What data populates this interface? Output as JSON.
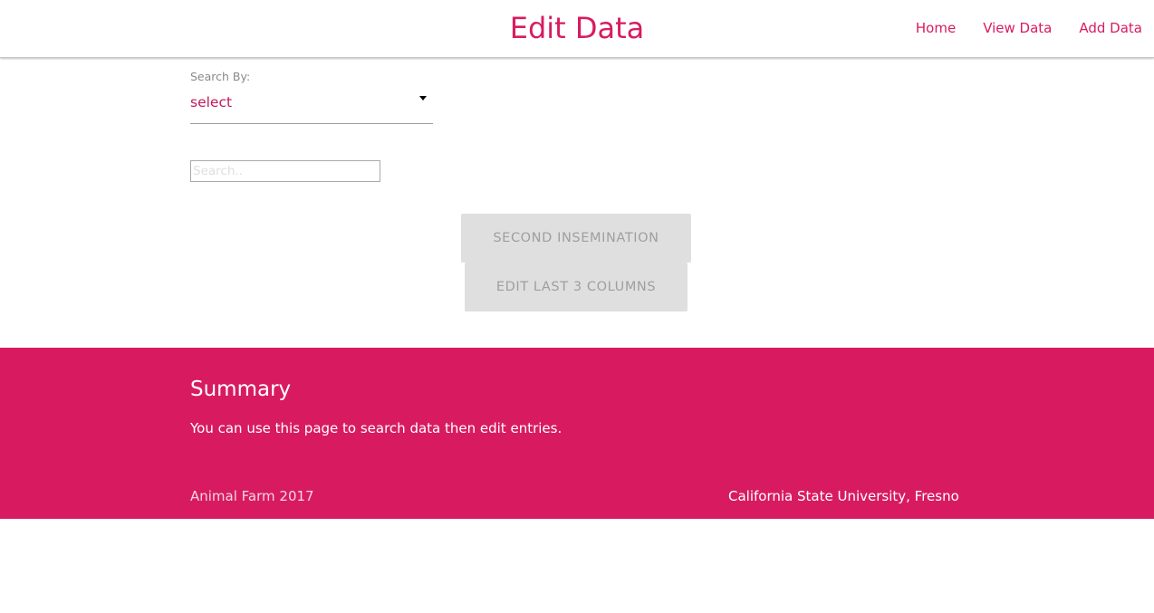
{
  "header": {
    "title": "Edit Data",
    "nav": [
      "Home",
      "View Data",
      "Add Data"
    ]
  },
  "form": {
    "search_by_label": "Search By:",
    "select_value": "select",
    "search_placeholder": "Search.."
  },
  "buttons": {
    "second_insemination": "SECOND INSEMINATION",
    "edit_last_3_columns": "EDIT LAST 3 COLUMNS"
  },
  "footer": {
    "summary_title": "Summary",
    "summary_text": "You can use this page to search data then edit entries.",
    "left_text": "Animal Farm 2017",
    "right_text": "California State University, Fresno"
  },
  "colors": {
    "accent": "#d81b60",
    "button_bg": "#dfdfdf",
    "button_text": "#9f9f9f"
  },
  "icons": {
    "select_caret": "caret-down-icon"
  }
}
